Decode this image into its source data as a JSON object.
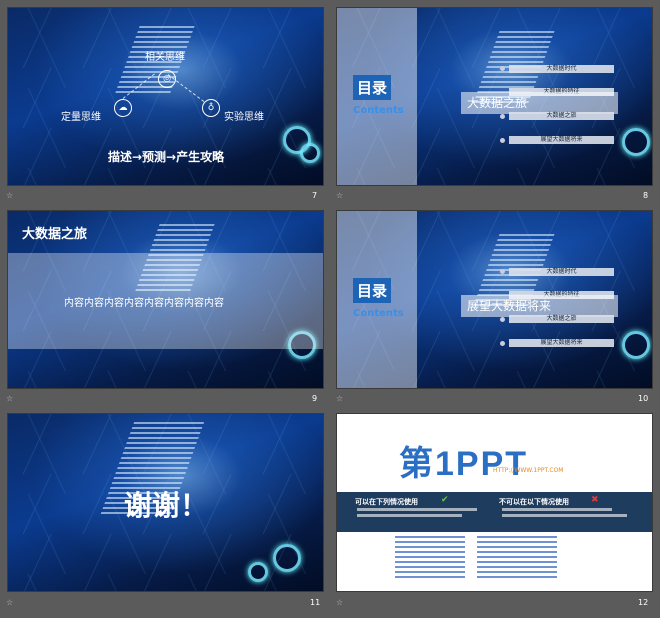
{
  "slides": [
    {
      "number": "7",
      "nodes": {
        "top": "相关思维",
        "left": "定量思维",
        "right": "实验思维"
      },
      "caption": "描述→预测→产生攻略"
    },
    {
      "number": "8",
      "title": "目录",
      "subtitle": "Contents",
      "highlight": "大数据之旅",
      "items": [
        "大数据时代",
        "大数据的特征",
        "大数据之旅",
        "展望大数据将来"
      ]
    },
    {
      "number": "9",
      "title": "大数据之旅",
      "content": "内容内容内容内容内容内容内容内容"
    },
    {
      "number": "10",
      "title": "目录",
      "subtitle": "Contents",
      "highlight": "展望大数据将来",
      "items": [
        "大数据时代",
        "大数据的特征",
        "大数据之旅",
        "展望大数据将来"
      ]
    },
    {
      "number": "11",
      "text": "谢谢！"
    },
    {
      "number": "12",
      "logo_text": "第1PPT",
      "logo_url": "HTTP://WWW.1PPT.COM",
      "can_use": "可以在下列情况使用",
      "cannot_use": "不可以在以下情况使用"
    }
  ],
  "icons": {
    "star": "☆",
    "check": "✔",
    "cross": "✖"
  }
}
